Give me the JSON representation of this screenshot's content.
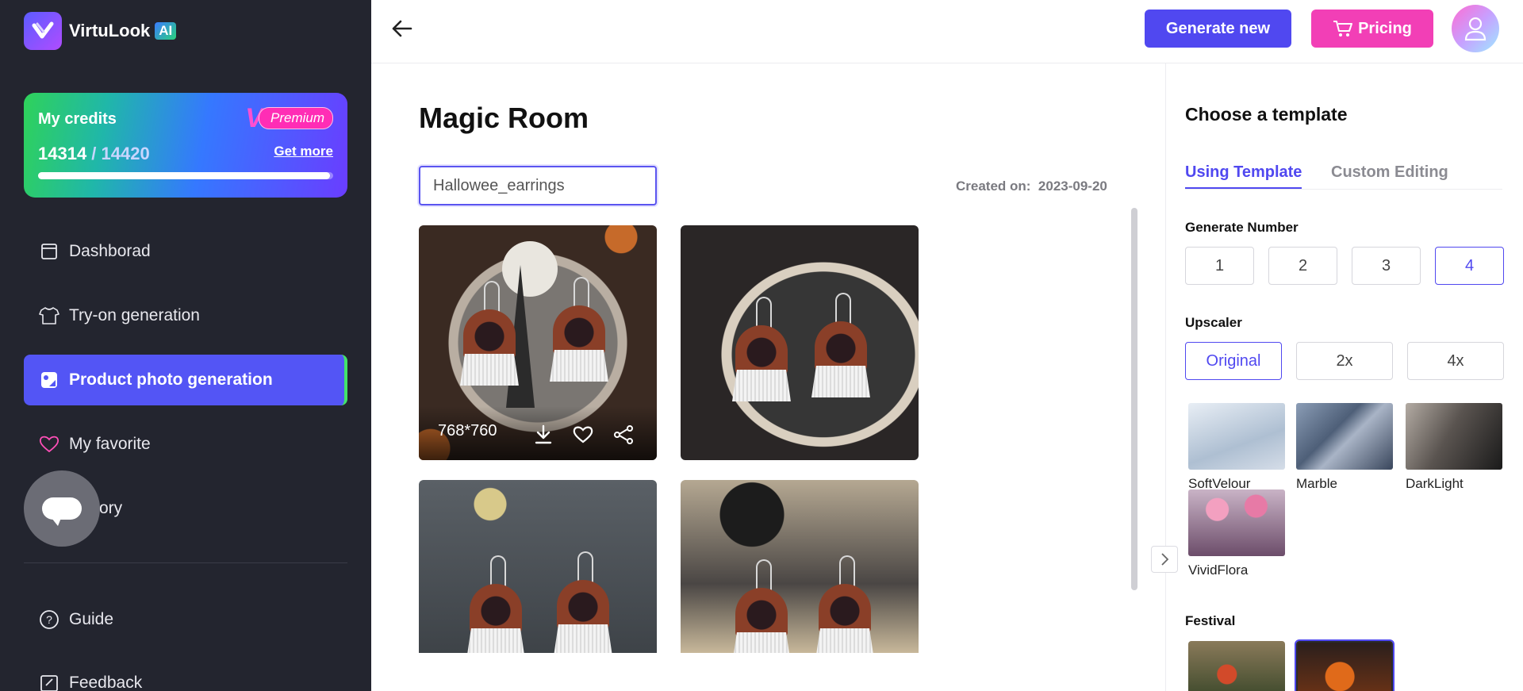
{
  "app": {
    "name": "VirtuLook",
    "badge": "AI"
  },
  "credits": {
    "title": "My credits",
    "premium_label": "Premium",
    "premium_mark": "V",
    "used": "14314",
    "separator": " / ",
    "total": "14420",
    "get_more": "Get more",
    "progress_fraction": 0.99
  },
  "sidebar": {
    "items": [
      {
        "label": "Dashborad",
        "icon": "dashboard-icon"
      },
      {
        "label": "Try-on generation",
        "icon": "tshirt-icon"
      },
      {
        "label": "Product photo generation",
        "icon": "product-photo-icon"
      },
      {
        "label": "My favorite",
        "icon": "heart-icon"
      },
      {
        "label": "ory",
        "icon": "history-icon"
      },
      {
        "label": "Guide",
        "icon": "question-icon"
      },
      {
        "label": "Feedback",
        "icon": "feedback-icon"
      }
    ]
  },
  "header": {
    "generate_new": "Generate new",
    "pricing": "Pricing"
  },
  "main": {
    "title": "Magic Room",
    "name_value": "Hallowee_earrings",
    "created_label": "Created on:",
    "created_date": "2023-09-20",
    "images": [
      {
        "dims": "768*760"
      }
    ]
  },
  "panel": {
    "title": "Choose a template",
    "tabs": [
      "Using Template",
      "Custom Editing"
    ],
    "generate_number_label": "Generate Number",
    "generate_numbers": [
      "1",
      "2",
      "3",
      "4"
    ],
    "upscaler_label": "Upscaler",
    "upscaler_options": [
      "Original",
      "2x",
      "4x"
    ],
    "templates": [
      "SoftVelour",
      "Marble",
      "DarkLight",
      "VividFlora"
    ],
    "festival_label": "Festival"
  },
  "colors": {
    "accent": "#5048f0",
    "pink": "#f23fb6",
    "sidebar": "#23252f",
    "active_indicator": "#43e36a"
  }
}
